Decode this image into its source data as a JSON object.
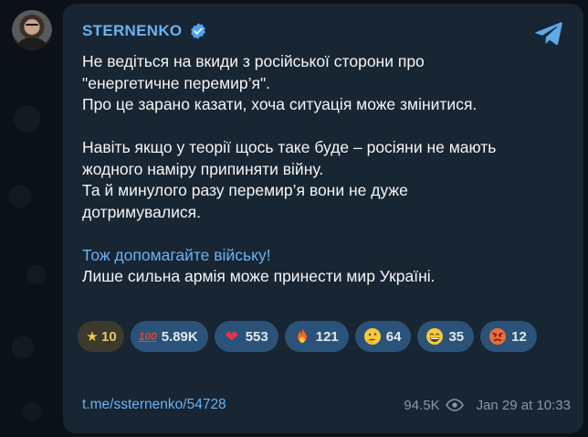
{
  "channel": {
    "name": "STERNENKO",
    "verified_icon": "verified-badge-icon",
    "app_icon": "telegram-icon"
  },
  "post": {
    "lines": [
      "Не ведіться на вкиди з російської сторони про",
      "\"енергетичне перемир’я\".",
      "Про це зарано казати, хоча ситуація може змінитися.",
      "",
      "Навіть якщо у теорії щось таке буде – росіяни не мають",
      "жодного наміру припиняти війну.",
      "Та й минулого разу перемир’я вони не дуже",
      "дотримувалися.",
      ""
    ],
    "link_line": "Тож допомагайте війську!",
    "last_line": "Лише сильна армія може принести мир Україні."
  },
  "reactions": [
    {
      "icon": "star-icon",
      "count": "10"
    },
    {
      "icon": "hundred-points-icon",
      "count": "5.89K"
    },
    {
      "icon": "red-heart-icon",
      "count": "553"
    },
    {
      "icon": "fire-icon",
      "count": "121"
    },
    {
      "icon": "thinking-face-icon",
      "count": "64"
    },
    {
      "icon": "grinning-face-icon",
      "count": "35"
    },
    {
      "icon": "angry-face-icon",
      "count": "12"
    }
  ],
  "footer": {
    "post_url": "t.me/ssternenko/54728",
    "views": "94.5K",
    "date": "Jan 29 at 10:33"
  },
  "colors": {
    "accent": "#6ab2f2",
    "bubble": "#182533",
    "reaction_bg": "#2b5278"
  }
}
